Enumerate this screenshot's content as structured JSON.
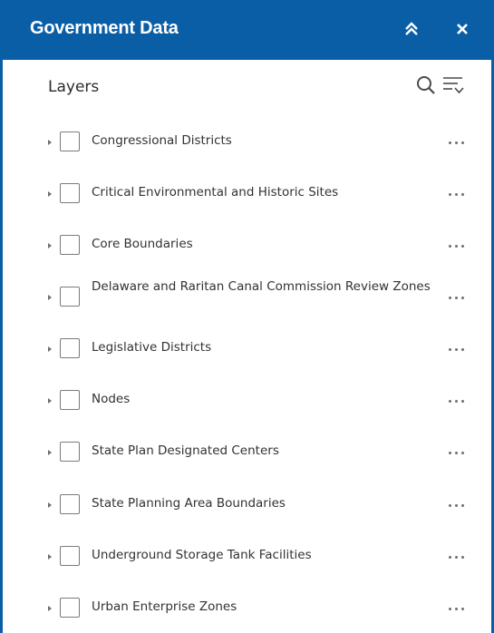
{
  "header": {
    "title": "Government Data",
    "collapse_icon": "double-chevron-up-icon",
    "close_icon": "close-icon"
  },
  "toolbar": {
    "title": "Layers",
    "search_icon": "search-icon",
    "filter_icon": "filter-icon"
  },
  "layers": [
    {
      "label": "Congressional Districts"
    },
    {
      "label": "Critical Environmental and Historic Sites"
    },
    {
      "label": "Core Boundaries"
    },
    {
      "label": "Delaware and Raritan Canal Commission Review Zones"
    },
    {
      "label": "Legislative Districts"
    },
    {
      "label": "Nodes"
    },
    {
      "label": "State Plan Designated Centers"
    },
    {
      "label": "State Planning Area Boundaries"
    },
    {
      "label": "Underground Storage Tank Facilities"
    },
    {
      "label": "Urban Enterprise Zones"
    }
  ],
  "colors": {
    "header_bg": "#0a5ea6",
    "header_text": "#ffffff",
    "label_text": "#323232",
    "checkbox_border": "#7b7b7b"
  }
}
